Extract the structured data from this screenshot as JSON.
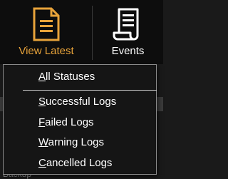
{
  "ribbon": {
    "view_latest": {
      "label": "View Latest",
      "icon": "document-icon",
      "color": "#e8a33a"
    },
    "events": {
      "label": "Events",
      "icon": "scroll-icon",
      "color": "#ffffff"
    }
  },
  "background": {
    "bottom_text": "Backup"
  },
  "menu": {
    "items": [
      {
        "first": "A",
        "rest": "ll Statuses"
      },
      {
        "first": "S",
        "rest": "uccessful Logs"
      },
      {
        "first": "F",
        "rest": "ailed Logs"
      },
      {
        "first": "W",
        "rest": "arning Logs"
      },
      {
        "first": "C",
        "rest": "ancelled Logs"
      }
    ]
  }
}
